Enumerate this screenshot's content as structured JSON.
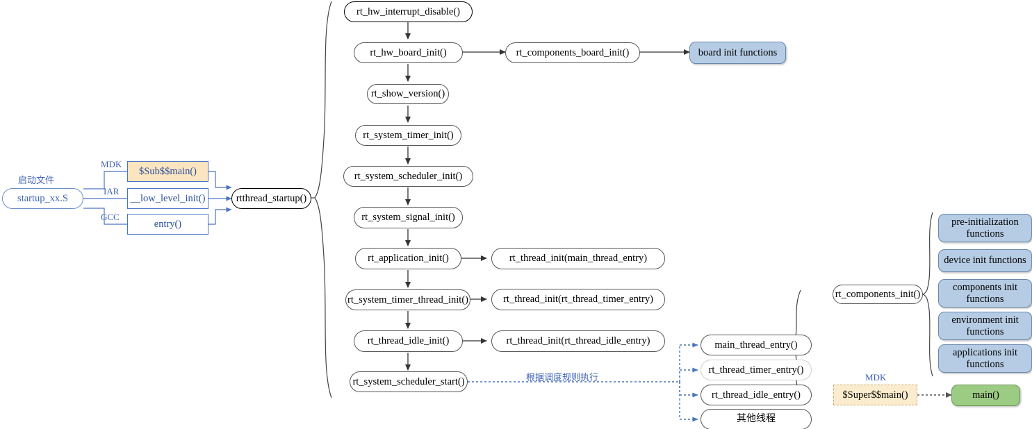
{
  "diagram": {
    "title": "RT-Thread startup flow",
    "colors": {
      "blue_fill": "#b6cce4",
      "green_fill": "#9ccb83",
      "tan_fill": "#fbeccd",
      "tan_fill_solid": "#fbe5c0",
      "blue_line": "#4a74c4",
      "blue_text": "#3f63b5",
      "node_border": "#555555"
    }
  },
  "startup": {
    "caption": "启动文件",
    "file_node": "startup_xx.S",
    "branches": [
      {
        "label": "MDK",
        "node": "$Sub$$main()"
      },
      {
        "label": "IAR",
        "node": "__low_level_init()"
      },
      {
        "label": "GCC",
        "node": "entry()"
      }
    ],
    "target": "rtthread_startup()"
  },
  "main_chain": [
    {
      "id": "n1",
      "label": "rt_hw_interrupt_disable()"
    },
    {
      "id": "n2",
      "label": "rt_hw_board_init()"
    },
    {
      "id": "n3",
      "label": "rt_show_version()"
    },
    {
      "id": "n4",
      "label": "rt_system_timer_init()"
    },
    {
      "id": "n5",
      "label": "rt_system_scheduler_init()"
    },
    {
      "id": "n6",
      "label": "rt_system_signal_init()"
    },
    {
      "id": "n7",
      "label": "rt_application_init()"
    },
    {
      "id": "n8",
      "label": "rt_system_timer_thread_init()"
    },
    {
      "id": "n9",
      "label": "rt_thread_idle_init()"
    },
    {
      "id": "n10",
      "label": "rt_system_scheduler_start()"
    }
  ],
  "side_nodes": {
    "components_board_init": "rt_components_board_init()",
    "board_init_functions": "board init functions",
    "thread_init_main": "rt_thread_init(main_thread_entry)",
    "thread_init_timer": "rt_thread_init(rt_thread_timer_entry)",
    "thread_init_idle": "rt_thread_init(rt_thread_idle_entry)"
  },
  "scheduler_edge_label": "根据调度规则执行",
  "thread_entries": [
    {
      "label": "main_thread_entry()",
      "style": "solid"
    },
    {
      "label": "rt_thread_timer_entry()",
      "style": "faint"
    },
    {
      "label": "rt_thread_idle_entry()",
      "style": "solid"
    },
    {
      "label": "其他线程",
      "style": "solid"
    }
  ],
  "components": {
    "init_node": "rt_components_init()",
    "functions": [
      "pre-initialization\nfunctions",
      "device init functions",
      "components init\nfunctions",
      "environment init\nfunctions",
      "applications init\nfunctions"
    ]
  },
  "super_main": {
    "toolchain_label": "MDK",
    "node": "$Super$$main()",
    "target": "main()"
  }
}
